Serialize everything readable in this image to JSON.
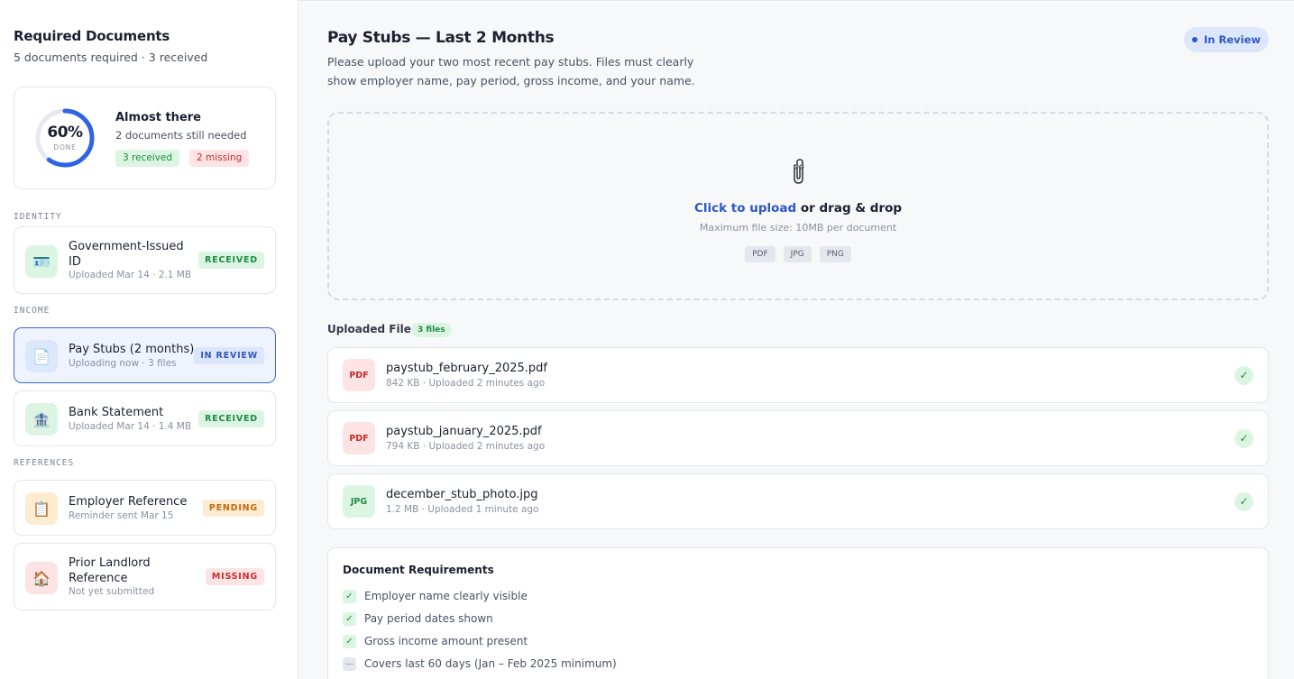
{
  "sidebar": {
    "title": "Required Documents",
    "subtitle": "5 documents required · 3 received",
    "progress": {
      "percent_value": 60,
      "percent_label": "60%",
      "done_label": "DONE",
      "title": "Almost there",
      "subtitle": "2 documents still needed",
      "received_pill": "3 received",
      "missing_pill": "2 missing"
    },
    "sections": {
      "identity": "IDENTITY",
      "income": "INCOME",
      "references": "REFERENCES"
    },
    "documents": [
      {
        "name": "Government-Issued ID",
        "meta": "Uploaded Mar 14 · 2.1 MB",
        "status": "RECEIVED",
        "icon": "id-card-icon"
      },
      {
        "name": "Pay Stubs (2 months)",
        "meta": "Uploading now · 3 files",
        "status": "IN REVIEW",
        "icon": "document-icon"
      },
      {
        "name": "Bank Statement",
        "meta": "Uploaded Mar 14 · 1.4 MB",
        "status": "RECEIVED",
        "icon": "bank-icon"
      },
      {
        "name": "Employer Reference",
        "meta": "Reminder sent Mar 15",
        "status": "PENDING",
        "icon": "clipboard-icon"
      },
      {
        "name": "Prior Landlord Reference",
        "meta": "Not yet submitted",
        "status": "MISSING",
        "icon": "house-icon"
      }
    ]
  },
  "main": {
    "title": "Pay Stubs — Last 2 Months",
    "description": "Please upload your two most recent pay stubs. Files must clearly show employer name, pay period, gross income, and your name.",
    "status_pill": "In Review",
    "dropzone": {
      "link_text": "Click to upload",
      "rest_text": " or drag & drop",
      "max_size": "Maximum file size: 10MB per document",
      "file_types": [
        "PDF",
        "JPG",
        "PNG"
      ]
    },
    "uploaded": {
      "label": "Uploaded Files",
      "count": "3 files",
      "files": [
        {
          "type": "PDF",
          "name": "paystub_february_2025.pdf",
          "meta": "842 KB · Uploaded 2 minutes ago"
        },
        {
          "type": "PDF",
          "name": "paystub_january_2025.pdf",
          "meta": "794 KB · Uploaded 2 minutes ago"
        },
        {
          "type": "JPG",
          "name": "december_stub_photo.jpg",
          "meta": "1.2 MB · Uploaded 1 minute ago"
        }
      ]
    },
    "requirements": {
      "title": "Document Requirements",
      "items": [
        {
          "text": "Employer name clearly visible",
          "done": true
        },
        {
          "text": "Pay period dates shown",
          "done": true
        },
        {
          "text": "Gross income amount present",
          "done": true
        },
        {
          "text": "Covers last 60 days (Jan – Feb 2025 minimum)",
          "done": false
        }
      ]
    }
  },
  "colors": {
    "accent": "#2f58c4",
    "success": "#1f8a45",
    "danger": "#cc2b2b",
    "warning": "#c46a10",
    "progress_ring": "#2f63e6"
  }
}
